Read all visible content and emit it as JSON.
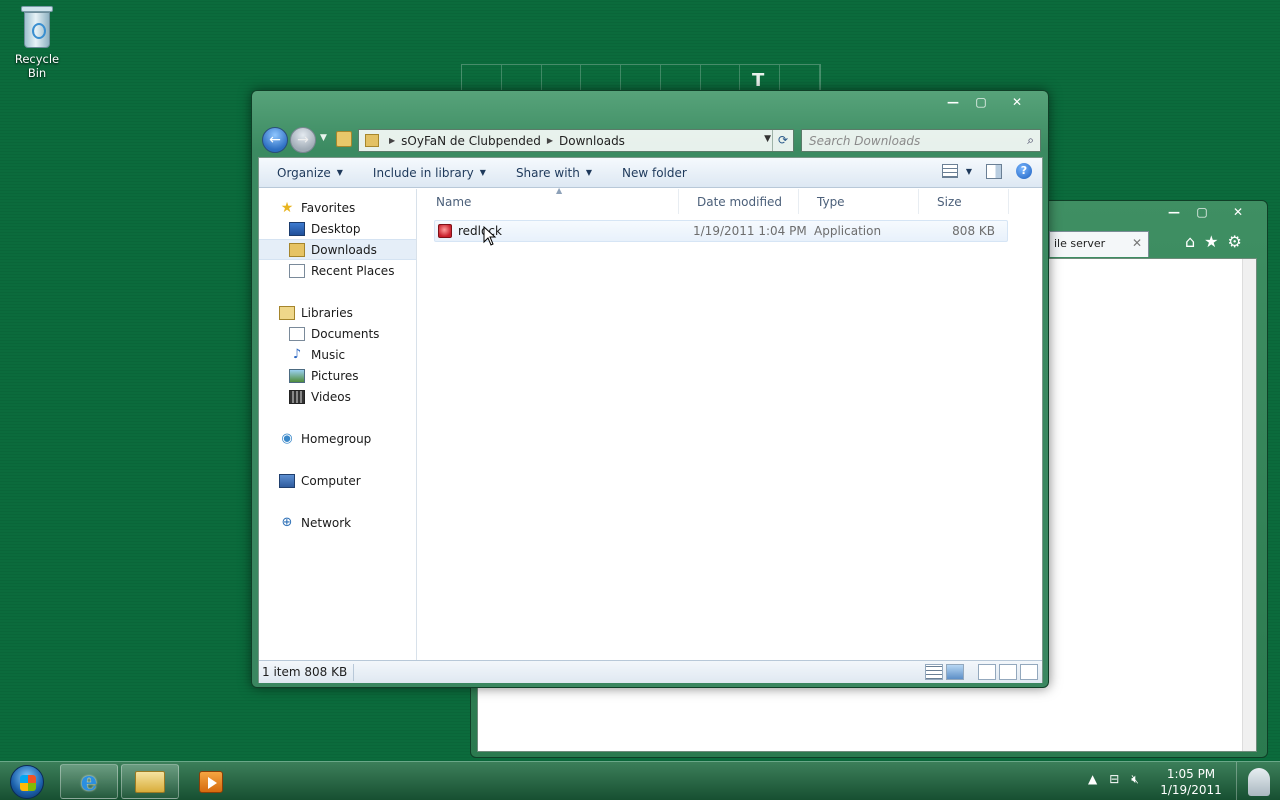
{
  "desktop": {
    "recycle_bin_label": "Recycle Bin"
  },
  "background_window": {
    "tab_label": "ile server",
    "tab_close": "✕"
  },
  "explorer": {
    "address": {
      "crumb_1": "sOyFaN de Clubpended",
      "crumb_2": "Downloads"
    },
    "search": {
      "placeholder": "Search Downloads"
    },
    "toolbar": {
      "organize": "Organize",
      "include_in_library": "Include in library",
      "share_with": "Share with",
      "new_folder": "New folder"
    },
    "nav": {
      "favorites": "Favorites",
      "desktop": "Desktop",
      "downloads": "Downloads",
      "recent_places": "Recent Places",
      "libraries": "Libraries",
      "documents": "Documents",
      "music": "Music",
      "pictures": "Pictures",
      "videos": "Videos",
      "homegroup": "Homegroup",
      "computer": "Computer",
      "network": "Network"
    },
    "columns": {
      "name": "Name",
      "date_modified": "Date modified",
      "type": "Type",
      "size": "Size"
    },
    "files": [
      {
        "name": "redlock",
        "date_modified": "1/19/2011 1:04 PM",
        "type": "Application",
        "size": "808 KB"
      }
    ],
    "status": {
      "summary": "1 item 808 KB"
    }
  },
  "taskbar": {
    "clock_time": "1:05 PM",
    "clock_date": "1/19/2011"
  }
}
